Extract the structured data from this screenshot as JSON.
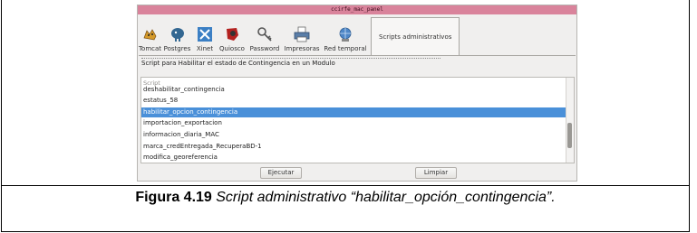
{
  "window": {
    "title": "ccirfe_mac_panel"
  },
  "tabs": [
    {
      "label": "Tomcat",
      "icon": "tomcat-icon"
    },
    {
      "label": "Postgres",
      "icon": "postgres-elephant-icon"
    },
    {
      "label": "Xinet",
      "icon": "xinet-icon"
    },
    {
      "label": "Quiosco",
      "icon": "quiosco-icon"
    },
    {
      "label": "Password",
      "icon": "key-icon"
    },
    {
      "label": "Impresoras",
      "icon": "printer-icon"
    },
    {
      "label": "Red temporal",
      "icon": "network-globe-icon"
    },
    {
      "label": "Scripts administrativos",
      "active": true
    }
  ],
  "panel": {
    "description": "Script para Habilitar el estado de Contingencia en un Modulo",
    "list_header": "Script",
    "items": [
      "deshabilitar_contingencia",
      "estatus_58",
      "habilitar_opcion_contingencia",
      "importacion_exportacion",
      "informacion_diaria_MAC",
      "marca_credEntregada_RecuperaBD-1",
      "modifica_georeferencia"
    ],
    "selected_index": 2,
    "execute_label": "Ejecutar",
    "clear_label": "Limpiar"
  },
  "caption": {
    "prefix": "Figura 4.19",
    "text": " Script administrativo “habilitar_opción_contingencia”."
  },
  "colors": {
    "titlebar": "#d9839b",
    "selection": "#4a90d9"
  }
}
